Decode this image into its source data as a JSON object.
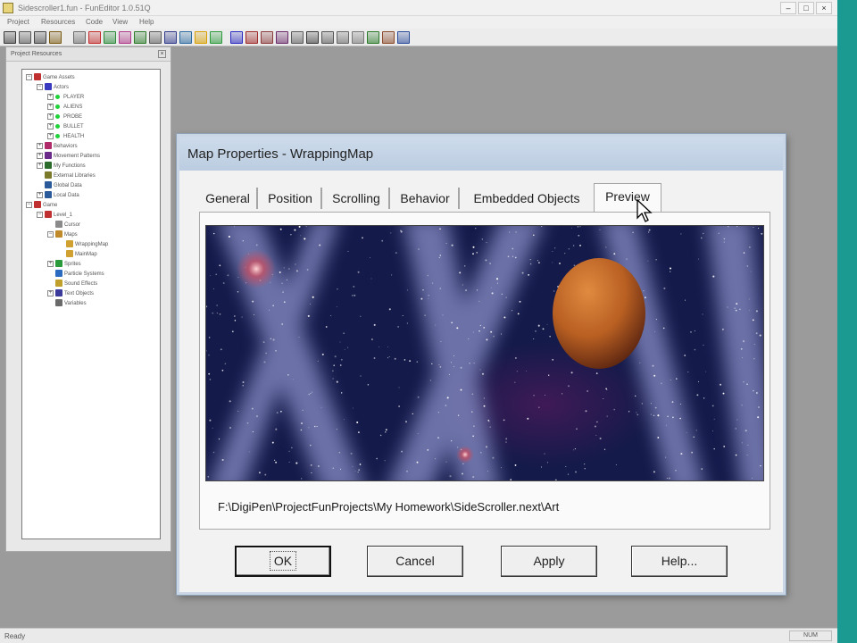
{
  "window": {
    "title": "Sidescroller1.fun - FunEditor 1.0.51Q",
    "controls": {
      "minimize": "–",
      "maximize": "□",
      "close": "×"
    }
  },
  "menu": [
    "Project",
    "Resources",
    "Code",
    "View",
    "Help"
  ],
  "toolbar": {
    "buttons": [
      {
        "icon": "bars-icon",
        "color": "#3a3a3a"
      },
      {
        "icon": "grid-icon",
        "color": "#555555"
      },
      {
        "icon": "library-icon",
        "color": "#444444"
      },
      {
        "icon": "trophy-icon",
        "color": "#7a5a10"
      },
      {
        "icon": "page-icon",
        "color": "#6b6b6b"
      },
      {
        "icon": "sprite-icon",
        "color": "#c42a2a"
      },
      {
        "icon": "actor-icon",
        "color": "#2a8a3a"
      },
      {
        "icon": "path-icon",
        "color": "#b03a8a"
      },
      {
        "icon": "node-icon",
        "color": "#2a7a2a"
      },
      {
        "icon": "tree-icon",
        "color": "#5a5a5a"
      },
      {
        "icon": "frame-icon",
        "color": "#303a8a"
      },
      {
        "icon": "clock-icon",
        "color": "#2a6aa0"
      },
      {
        "icon": "star-icon",
        "color": "#d7a000"
      },
      {
        "icon": "puzzle-icon",
        "color": "#2a9a3a"
      },
      {
        "icon": "stop-icon",
        "color": "#2a2ac0"
      },
      {
        "icon": "people-icon",
        "color": "#a02a2a"
      },
      {
        "icon": "wand-icon",
        "color": "#8a3a3a"
      },
      {
        "icon": "arrow-icon",
        "color": "#6a2a6a"
      },
      {
        "icon": "select-icon",
        "color": "#5a5a5a"
      },
      {
        "icon": "step-icon",
        "color": "#3a3a3a"
      },
      {
        "icon": "merge-icon",
        "color": "#555555"
      },
      {
        "icon": "columns-icon",
        "color": "#666666"
      },
      {
        "icon": "list-icon",
        "color": "#777777"
      },
      {
        "icon": "refresh-icon",
        "color": "#2a7a2a"
      },
      {
        "icon": "tools-icon",
        "color": "#8a4a2a"
      },
      {
        "icon": "globe-icon",
        "color": "#2a4a9a"
      }
    ]
  },
  "project_panel": {
    "title": "Project Resources",
    "tree": [
      {
        "label": "Game Assets",
        "depth": 0,
        "expander": "−",
        "icon": "game-assets-icon",
        "icon_color": "#c03030"
      },
      {
        "label": "Actors",
        "depth": 1,
        "expander": "−",
        "icon": "actors-icon",
        "icon_color": "#3a3ac0"
      },
      {
        "label": "PLAYER",
        "depth": 2,
        "expander": "+",
        "dot": true
      },
      {
        "label": "ALIENS",
        "depth": 2,
        "expander": "+",
        "dot": true
      },
      {
        "label": "PROBE",
        "depth": 2,
        "expander": "+",
        "dot": true
      },
      {
        "label": "BULLET",
        "depth": 2,
        "expander": "+",
        "dot": true
      },
      {
        "label": "HEALTH",
        "depth": 2,
        "expander": "+",
        "dot": true
      },
      {
        "label": "Behaviors",
        "depth": 1,
        "expander": "+",
        "icon": "behaviors-icon",
        "icon_color": "#b02a6a"
      },
      {
        "label": "Movement Patterns",
        "depth": 1,
        "expander": "+",
        "icon": "movement-icon",
        "icon_color": "#6a2a8a"
      },
      {
        "label": "My Functions",
        "depth": 1,
        "expander": "+",
        "icon": "functions-icon",
        "icon_color": "#2a6a2a"
      },
      {
        "label": "External Libraries",
        "depth": 1,
        "expander": "",
        "icon": "libraries-icon",
        "icon_color": "#7a7a2a"
      },
      {
        "label": "Global Data",
        "depth": 1,
        "expander": "",
        "icon": "global-data-icon",
        "icon_color": "#2a5a9a"
      },
      {
        "label": "Local Data",
        "depth": 1,
        "expander": "+",
        "icon": "local-data-icon",
        "icon_color": "#2a5a9a"
      },
      {
        "label": "Game",
        "depth": 0,
        "expander": "−",
        "icon": "game-icon",
        "icon_color": "#c03030"
      },
      {
        "label": "Level_1",
        "depth": 1,
        "expander": "−",
        "icon": "level-icon",
        "icon_color": "#c03030"
      },
      {
        "label": "Cursor",
        "depth": 2,
        "expander": "",
        "icon": "cursor-icon",
        "icon_color": "#8a8a8a"
      },
      {
        "label": "Maps",
        "depth": 2,
        "expander": "−",
        "icon": "maps-icon",
        "icon_color": "#c08a2a"
      },
      {
        "label": "WrappingMap",
        "depth": 3,
        "expander": "",
        "icon": "map-icon",
        "icon_color": "#d0a030"
      },
      {
        "label": "MainMap",
        "depth": 3,
        "expander": "",
        "icon": "map-icon",
        "icon_color": "#d0a030"
      },
      {
        "label": "Sprites",
        "depth": 2,
        "expander": "+",
        "icon": "sprites-icon",
        "icon_color": "#2a9a3a"
      },
      {
        "label": "Particle Systems",
        "depth": 2,
        "expander": "",
        "icon": "particles-icon",
        "icon_color": "#2a6ac0"
      },
      {
        "label": "Sound Effects",
        "depth": 2,
        "expander": "",
        "icon": "sound-icon",
        "icon_color": "#c0a02a"
      },
      {
        "label": "Text Objects",
        "depth": 2,
        "expander": "+",
        "icon": "text-icon",
        "icon_color": "#3a3a9a"
      },
      {
        "label": "Variables",
        "depth": 2,
        "expander": "",
        "icon": "variables-icon",
        "icon_color": "#6a6a6a"
      }
    ]
  },
  "dialog": {
    "title": "Map Properties - WrappingMap",
    "tabs": [
      {
        "label": "General",
        "active": false
      },
      {
        "label": "Position",
        "active": false
      },
      {
        "label": "Scrolling",
        "active": false
      },
      {
        "label": "Behavior",
        "active": false
      },
      {
        "label": "Embedded Objects",
        "active": false
      },
      {
        "label": "Preview",
        "active": true
      }
    ],
    "file_path": "F:\\DigiPen\\ProjectFunProjects\\My Homework\\SideScroller.next\\Art",
    "buttons": {
      "ok": "OK",
      "cancel": "Cancel",
      "apply": "Apply",
      "help": "Help..."
    }
  },
  "status": {
    "text": "Ready",
    "num": "NUM"
  },
  "colors": {
    "teal_strip": "#1b9a91",
    "dialog_title_bg": "#c5d5e8",
    "tree_dot": "#1fd23a",
    "planet": "#b85f22"
  }
}
